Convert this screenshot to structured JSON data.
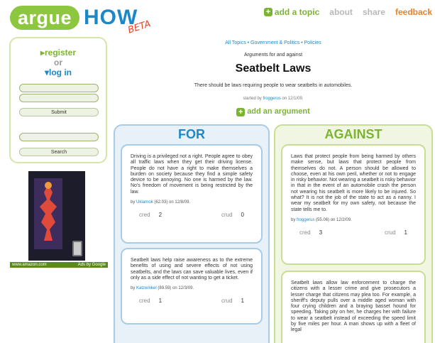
{
  "logo": {
    "argue": "argue",
    "how": "HOW",
    "beta": "BETA"
  },
  "topnav": {
    "add_topic": "add a topic",
    "about": "about",
    "share": "share",
    "feedback": "feedback"
  },
  "auth": {
    "register": "register",
    "or": "or",
    "login": "log in",
    "submit_label": "Submit",
    "search_label": "Search"
  },
  "ad": {
    "left_link": "www.amazon.com",
    "right_link": "Ads by Google"
  },
  "breadcrumb": "All Topics • Government & Politics • Policies",
  "subtitle": "Arguments for and against",
  "title": "Seatbelt Laws",
  "description": "There should be laws requiring people to wear seatbelts in automobiles.",
  "started": {
    "prefix": "started by ",
    "user": "froggerus",
    "suffix": " on 12/1/09."
  },
  "add_argument": "add an argument",
  "for": {
    "heading": "FOR",
    "cards": [
      {
        "text": "Driving is a privileged not a right. People agree to obey all traffic laws when they get their driving license. People do not have a right to make themselves a burden on society because they find a simple safety device to be annoying. No one is harmed by the law. No's freedom of movement is being restricted by the law.",
        "by_prefix": "by ",
        "user": "Uklarnok",
        "by_suffix": " (62.03) on 12/8/09.",
        "cred_label": "cred",
        "cred": "2",
        "crud_label": "crud",
        "crud": "0"
      },
      {
        "text": "Seatbelt laws help raise awareness as to the extreme benefits of using and severe effects of not using seatbelts, and the laws can save valuable lives, even if only as a side effect of not wanting to get a ticket.",
        "by_prefix": "by ",
        "user": "Katzwinkel",
        "by_suffix": " (89.59) on 12/3/09.",
        "cred_label": "cred",
        "cred": "1",
        "crud_label": "crud",
        "crud": "1"
      }
    ]
  },
  "against": {
    "heading": "AGAINST",
    "cards": [
      {
        "text": "Laws that protect people from being harmed by others make sense, but laws that protect people from themselves do not. A person should be allowed to choose, even at his own peril, whether or not to engage in risky behavior. Not wearing a seatbelt is risky behavior in that in the event of an automobile crash the person not wearing his seatbelt is more likely to be injured. So what? It is not the job of the state to act as a nanny. I wear my seatbelt for my own safety, not because the state tells me to.",
        "by_prefix": "by ",
        "user": "froggerus",
        "by_suffix": " (55.06) on 12/2/09.",
        "cred_label": "cred",
        "cred": "3",
        "crud_label": "crud",
        "crud": "1"
      },
      {
        "text": "Seatbelt laws allow law enforcement to charge the citizens with a lesser crime and give prosecutors a lesser charge that citizens may plea too. For example, a sheriff's deputy pulls over a middle aged woman with four crying children and a braying basset hound for speeding. Taking pity on her, he charges her with failure to wear a seatbelt instead of exceeding the speed limit by five miles per hour. A man shows up with a fleet of legal"
      }
    ]
  }
}
